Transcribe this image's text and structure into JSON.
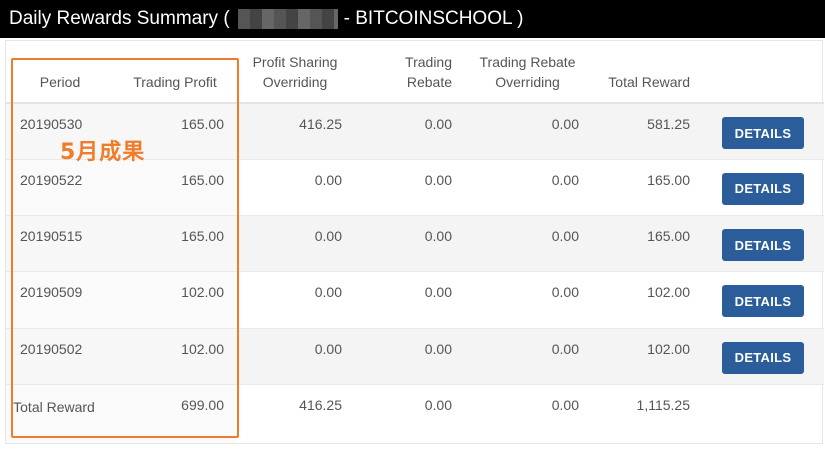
{
  "header": {
    "title_prefix": "Daily Rewards Summary (",
    "title_suffix": "- BITCOINSCHOOL )"
  },
  "table": {
    "columns": [
      "Period",
      "Trading Profit",
      "Profit Sharing Overriding",
      "Trading Rebate",
      "Trading Rebate Overriding",
      "Total Reward",
      ""
    ],
    "rows": [
      {
        "period": "20190530",
        "trading_profit": "165.00",
        "profit_sharing": "416.25",
        "trading_rebate": "0.00",
        "rebate_overriding": "0.00",
        "total_reward": "581.25",
        "action": "DETAILS"
      },
      {
        "period": "20190522",
        "trading_profit": "165.00",
        "profit_sharing": "0.00",
        "trading_rebate": "0.00",
        "rebate_overriding": "0.00",
        "total_reward": "165.00",
        "action": "DETAILS"
      },
      {
        "period": "20190515",
        "trading_profit": "165.00",
        "profit_sharing": "0.00",
        "trading_rebate": "0.00",
        "rebate_overriding": "0.00",
        "total_reward": "165.00",
        "action": "DETAILS"
      },
      {
        "period": "20190509",
        "trading_profit": "102.00",
        "profit_sharing": "0.00",
        "trading_rebate": "0.00",
        "rebate_overriding": "0.00",
        "total_reward": "102.00",
        "action": "DETAILS"
      },
      {
        "period": "20190502",
        "trading_profit": "102.00",
        "profit_sharing": "0.00",
        "trading_rebate": "0.00",
        "rebate_overriding": "0.00",
        "total_reward": "102.00",
        "action": "DETAILS"
      }
    ],
    "total": {
      "label": "Total Reward",
      "trading_profit": "699.00",
      "profit_sharing": "416.25",
      "trading_rebate": "0.00",
      "rebate_overriding": "0.00",
      "total_reward": "1,115.25"
    }
  },
  "annotation": {
    "text": "5月成果",
    "color": "#ef7c2a"
  },
  "colors": {
    "button": "#2a5d9a",
    "title_bar": "#000000",
    "highlight": "#ef7c2a"
  }
}
